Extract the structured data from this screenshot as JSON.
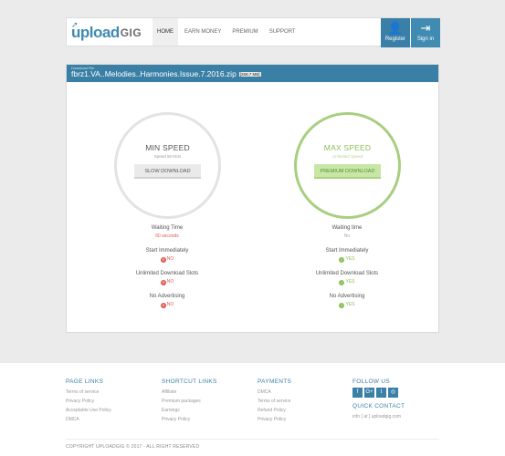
{
  "logo": {
    "part1": "upload",
    "part2": "GIG"
  },
  "nav": [
    {
      "label": "HOME",
      "active": true
    },
    {
      "label": "EARN MONEY",
      "active": false
    },
    {
      "label": "PREMIUM",
      "active": false
    },
    {
      "label": "SUPPORT",
      "active": false
    }
  ],
  "auth": {
    "register": "Register",
    "signin": "Sign in"
  },
  "file": {
    "label": "Download File",
    "name": "fbrz1.VA..Melodies..Harmonies.Issue.7.2016.zip",
    "size": "[269.7 MB]"
  },
  "min": {
    "title": "MIN SPEED",
    "speed": "Speed 50 Kb/s",
    "button": "SLOW DOWNLOAD",
    "features": [
      {
        "label": "Waiting Time",
        "value": "60 seconds"
      },
      {
        "label": "Start Immediately",
        "value": "NO"
      },
      {
        "label": "Unlimited Download Slots",
        "value": "NO"
      },
      {
        "label": "No Advertising",
        "value": "NO"
      }
    ]
  },
  "max": {
    "title": "MAX SPEED",
    "speed": "Unlimited Speed",
    "button": "PREMIUM DOWNLOAD",
    "features": [
      {
        "label": "Waiting time",
        "value": "No"
      },
      {
        "label": "Start Immediately",
        "value": "YES"
      },
      {
        "label": "Unlimited Download Slots",
        "value": "YES"
      },
      {
        "label": "No Advertising",
        "value": "YES"
      }
    ]
  },
  "footer": {
    "page_links": {
      "title": "PAGE LINKS",
      "items": [
        "Terms of service",
        "Privacy Policy",
        "Acceptable Use Policy",
        "DMCA"
      ]
    },
    "shortcut_links": {
      "title": "SHORTCUT LINKS",
      "items": [
        "Affiliate",
        "Premium packages",
        "Earnings",
        "Privacy Policy"
      ]
    },
    "payments": {
      "title": "PAYMENTS",
      "items": [
        "DMCA",
        "Terms of service",
        "Refund Policy",
        "Privacy Policy"
      ]
    },
    "follow": {
      "title": "FOLLOW US",
      "icons": [
        "f",
        "G+",
        "t",
        "◎"
      ]
    },
    "contact": {
      "title": "QUICK CONTACT",
      "email": "info [ at ] uploadgig.com"
    },
    "copyright": "COPYRIGHT UPLOADGIG © 2017 - ALL RIGHT RESERVED"
  },
  "colors": {
    "brand": "#3a80a6",
    "green": "#8cbf5a",
    "red": "#e05a4f"
  }
}
